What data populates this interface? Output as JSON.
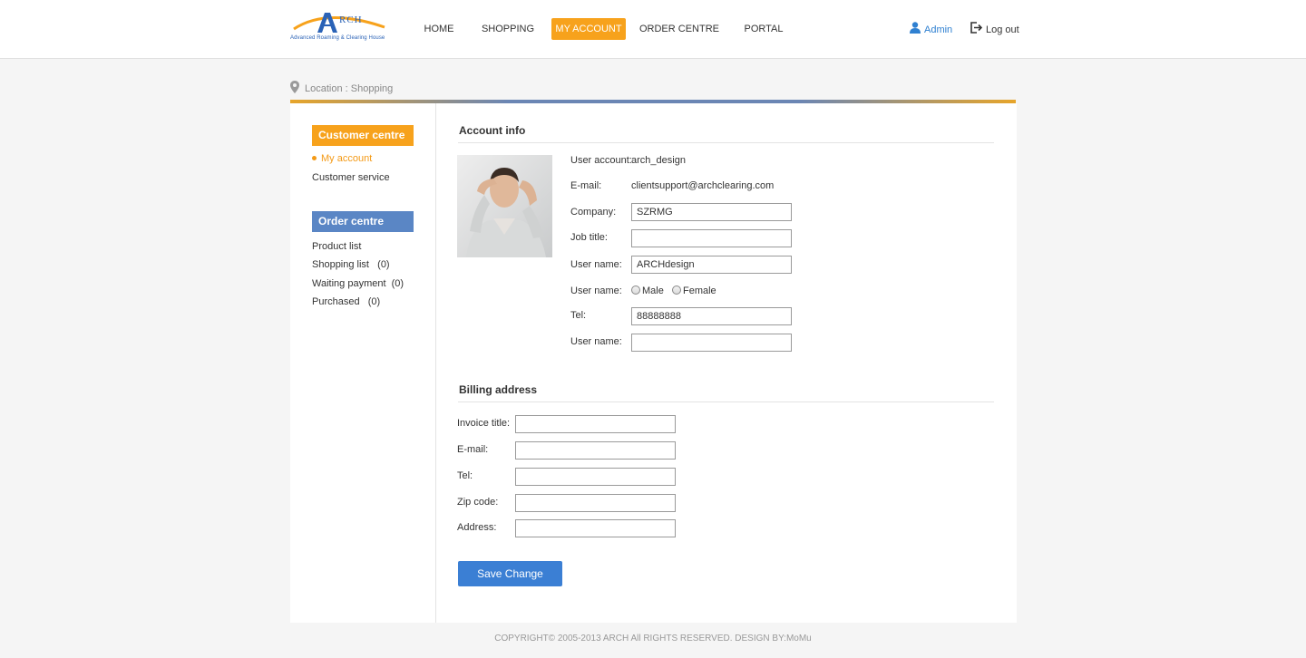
{
  "brand": {
    "logo_text": "RCH",
    "logo_letter": "A",
    "tagline": "Advanced Roaming & Clearing House"
  },
  "nav": {
    "items": [
      {
        "label": "HOME"
      },
      {
        "label": "SHOPPING"
      },
      {
        "label": "MY ACCOUNT",
        "active": true
      },
      {
        "label": "ORDER CENTRE"
      },
      {
        "label": "PORTAL"
      }
    ],
    "user_label": "Admin",
    "logout_label": "Log out"
  },
  "breadcrumb": {
    "prefix": "Location :",
    "current": "Shopping"
  },
  "sidebar": {
    "customer_centre": {
      "title": "Customer centre",
      "items": [
        {
          "label": "My account",
          "active": true
        },
        {
          "label": "Customer service"
        }
      ]
    },
    "order_centre": {
      "title": "Order centre",
      "items": [
        {
          "label": "Product list"
        },
        {
          "label": "Shopping list   (0)"
        },
        {
          "label": "Waiting payment  (0)"
        },
        {
          "label": "Purchased   (0)"
        }
      ]
    }
  },
  "account_info": {
    "title": "Account info",
    "user_account_label": "User account:",
    "user_account_value": "arch_design",
    "email_label": "E-mail:",
    "email_value": "clientsupport@archclearing.com",
    "company_label": "Company:",
    "company_value": "SZRMG",
    "job_title_label": "Job title:",
    "job_title_value": "",
    "user_name_label": "User name:",
    "user_name_value": "ARCHdesign",
    "gender_label": "User name:",
    "gender_options": [
      "Male",
      "Female"
    ],
    "tel_label": "Tel:",
    "tel_value": "88888888",
    "user_name2_label": "User name:",
    "user_name2_value": ""
  },
  "billing": {
    "title": "Billing address",
    "invoice_label": "Invoice title:",
    "email_label": "E-mail:",
    "tel_label": "Tel:",
    "zip_label": "Zip code:",
    "address_label": "Address:"
  },
  "save_label": "Save Change",
  "footer": "COPYRIGHT© 2005-2013 ARCH All RIGHTS RESERVED. DESIGN BY:MoMu",
  "colors": {
    "accent_orange": "#f7a21c",
    "accent_blue": "#3b7fd4",
    "sidebar_blue": "#5a86c5"
  }
}
